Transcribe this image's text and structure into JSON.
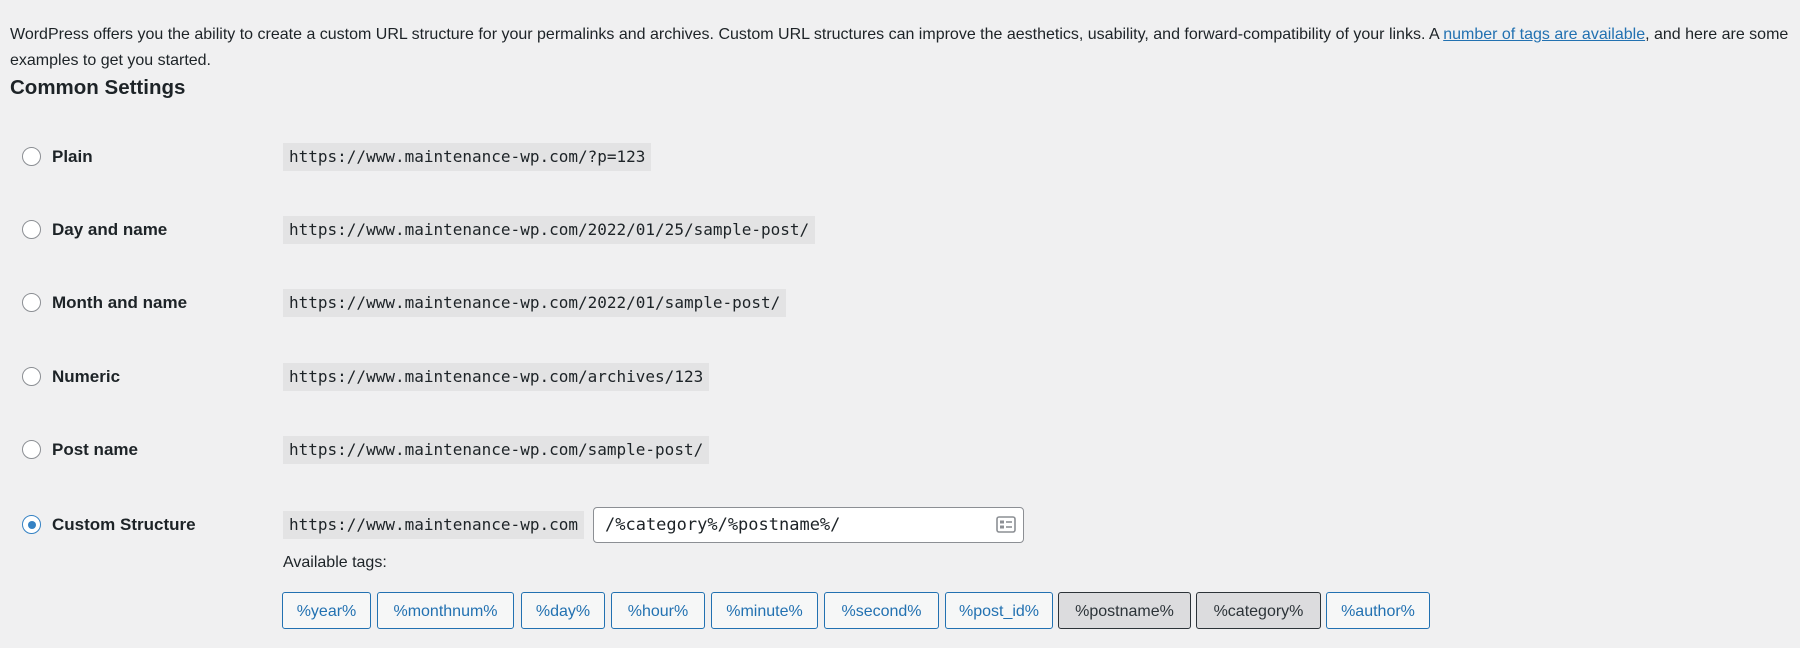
{
  "intro": {
    "text_before": "WordPress offers you the ability to create a custom URL structure for your permalinks and archives. Custom URL structures can improve the aesthetics, usability, and forward-compatibility of your links. A ",
    "link_text": "number of tags are available",
    "text_after": ", and here are some examples to get you started."
  },
  "section_title": "Common Settings",
  "options": [
    {
      "label": "Plain",
      "example": "https://www.maintenance-wp.com/?p=123",
      "checked": false
    },
    {
      "label": "Day and name",
      "example": "https://www.maintenance-wp.com/2022/01/25/sample-post/",
      "checked": false
    },
    {
      "label": "Month and name",
      "example": "https://www.maintenance-wp.com/2022/01/sample-post/",
      "checked": false
    },
    {
      "label": "Numeric",
      "example": "https://www.maintenance-wp.com/archives/123",
      "checked": false
    },
    {
      "label": "Post name",
      "example": "https://www.maintenance-wp.com/sample-post/",
      "checked": false
    },
    {
      "label": "Custom Structure",
      "example": "https://www.maintenance-wp.com",
      "checked": true
    }
  ],
  "custom_structure": {
    "value": "/%category%/%postname%/",
    "icon": "form-icon"
  },
  "available_tags_label": "Available tags:",
  "tags": [
    {
      "label": "%year%",
      "active": false
    },
    {
      "label": "%monthnum%",
      "active": false
    },
    {
      "label": "%day%",
      "active": false
    },
    {
      "label": "%hour%",
      "active": false
    },
    {
      "label": "%minute%",
      "active": false
    },
    {
      "label": "%second%",
      "active": false
    },
    {
      "label": "%post_id%",
      "active": false
    },
    {
      "label": "%postname%",
      "active": true
    },
    {
      "label": "%category%",
      "active": true
    },
    {
      "label": "%author%",
      "active": false
    }
  ],
  "colors": {
    "background": "#f0f0f1",
    "link": "#2271b1",
    "radio_checked": "#3582c4",
    "code_background": "#e3e3e4"
  }
}
